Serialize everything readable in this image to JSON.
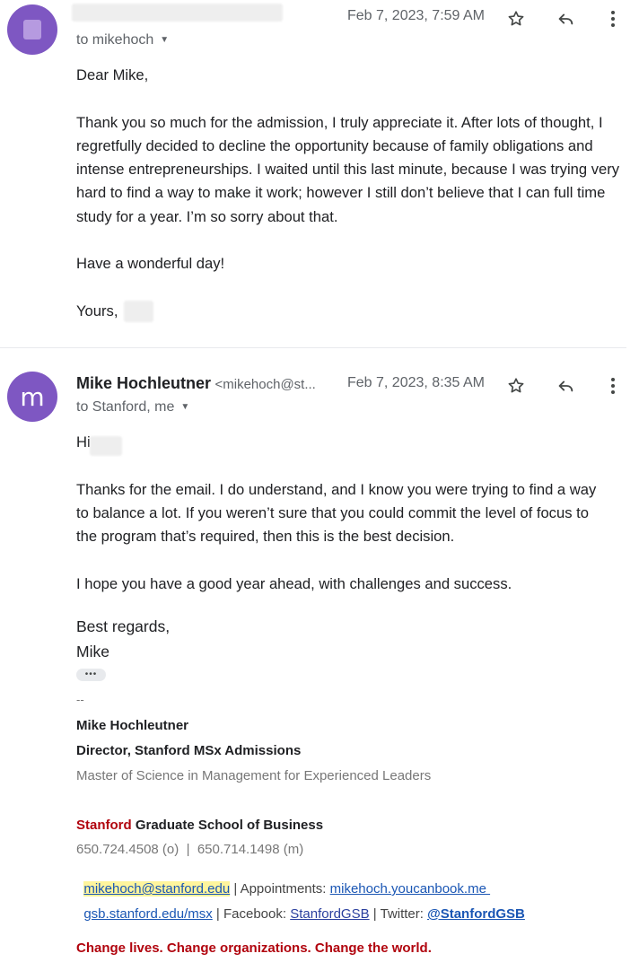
{
  "email1": {
    "date": "Feb 7, 2023, 7:59 AM",
    "to": "to mikehoch",
    "greeting": "Dear Mike,",
    "body": "Thank you so much for the admission, I truly appreciate it. After lots of thought, I regretfully decided to decline the opportunity because of family obligations and intense entrepreneurships. I waited until this last minute, because I was trying very hard to find a way to make it work; however I still don’t believe that I can full time study for a year. I’m so sorry about that.",
    "wish": "Have a wonderful day!",
    "closing": "Yours,"
  },
  "email2": {
    "avatar_letter": "m",
    "sender_name": "Mike Hochleutner",
    "sender_email": "<mikehoch@st...",
    "date": "Feb 7, 2023, 8:35 AM",
    "to": "to Stanford, me",
    "greeting": "Hi",
    "body": "Thanks for the email. I do understand, and I know you were trying to find a way to balance a lot. If you weren’t sure that you could commit the level of focus to the program that’s required, then this is the best decision.",
    "hope": "I hope you have a good year ahead, with challenges and success.",
    "regards": "Best regards,",
    "name": "Mike",
    "dots": "•••"
  },
  "signature": {
    "dash": "--",
    "name": "Mike Hochleutner",
    "title": "Director, Stanford MSx Admissions",
    "program": "Master of Science in Management for Experienced Leaders",
    "school_red": "Stanford",
    "school_rest": " Graduate School of Business",
    "phones": "650.724.4508 (o)  |  650.714.1498 (m)",
    "email": "mikehoch@stanford.edu",
    "appointments_label": " | Appointments: ",
    "appointments_link": "mikehoch.youcanbook.me ",
    "website": "gsb.stanford.edu/msx",
    "facebook_label": " | Facebook: ",
    "facebook_link": "StanfordGSB",
    "twitter_label": " | Twitter: ",
    "twitter_link": "@StanfordGSB",
    "tagline": "Change lives. Change organizations. Change the world."
  },
  "icons": {
    "star": "star-icon",
    "reply": "reply-icon",
    "more": "more-vert-icon",
    "dropdown": "chevron-down-icon"
  },
  "colors": {
    "avatar": "#7e57c2",
    "stanford_red": "#b1040e",
    "link": "#1a56b4",
    "highlight": "#fff59d"
  }
}
